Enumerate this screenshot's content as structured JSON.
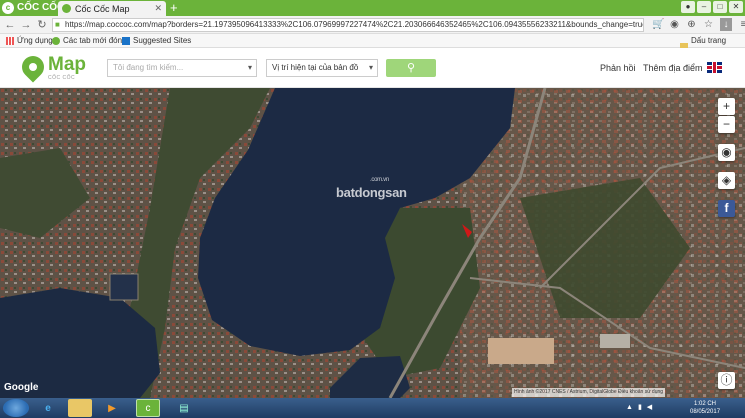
{
  "browser": {
    "brand": "CỐC CỐC",
    "tab_title": "Cốc Cốc Map",
    "new_tab_symbol": "+",
    "url": "https://map.coccoc.com/map?borders=21.197395096413333%2C106.07969997227474%2C21.203066646352465%2C106.09435556233211&bounds_change=true",
    "bookmarks": {
      "apps": "Ứng dụng",
      "newtab": "Các tab mới đóng",
      "suggested": "Suggested Sites",
      "other": "Dấu trang khác"
    }
  },
  "header": {
    "logo_name": "Map",
    "logo_sub": "CỐC CỐC",
    "search_placeholder": "Tôi đang tìm kiếm...",
    "scope_value": "Vị trí hiện tại của bản đồ",
    "feedback": "Phản hồi",
    "add_place": "Thêm địa điểm"
  },
  "map": {
    "watermark_main": "batdongsan",
    "watermark_domain": ".com.vn",
    "zoom_in": "+",
    "zoom_out": "−",
    "google": "Google",
    "attribution": "Hình ảnh ©2017 CNES / Astrium, DigitalGlobe   Điều khoản sử dụng",
    "facebook_label": "f"
  },
  "taskbar": {
    "clock_time": "1:02 CH",
    "clock_date": "08/05/2017"
  },
  "colors": {
    "brand_green": "#6bb33a",
    "water": "#1c2a44",
    "urban": "#6a5a4a"
  }
}
